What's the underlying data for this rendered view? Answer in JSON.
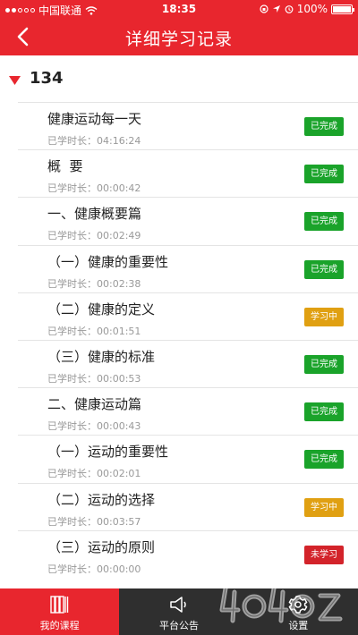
{
  "status_bar": {
    "carrier": "中国联通",
    "time": "18:35",
    "battery_percent": "100%",
    "battery_level": 1.0
  },
  "header": {
    "title": "详细学习记录",
    "back_icon": "chevron-left-icon"
  },
  "course": {
    "id": "134",
    "expand_icon": "triangle-down-icon"
  },
  "records": [
    {
      "title": "健康运动每一天",
      "time": "已学时长：04:16:24",
      "status": "已完成",
      "state": "done"
    },
    {
      "title": "概  要",
      "time": "已学时长：00:00:42",
      "status": "已完成",
      "state": "done"
    },
    {
      "title": "一、健康概要篇",
      "time": "已学时长：00:02:49",
      "status": "已完成",
      "state": "done"
    },
    {
      "title": "（一）健康的重要性",
      "time": "已学时长：00:02:38",
      "status": "已完成",
      "state": "done"
    },
    {
      "title": "（二）健康的定义",
      "time": "已学时长：00:01:51",
      "status": "学习中",
      "state": "learning"
    },
    {
      "title": "（三）健康的标准",
      "time": "已学时长：00:00:53",
      "status": "已完成",
      "state": "done"
    },
    {
      "title": "二、健康运动篇",
      "time": "已学时长：00:00:43",
      "status": "已完成",
      "state": "done"
    },
    {
      "title": "（一）运动的重要性",
      "time": "已学时长：00:02:01",
      "status": "已完成",
      "state": "done"
    },
    {
      "title": "（二）运动的选择",
      "time": "已学时长：00:03:57",
      "status": "学习中",
      "state": "learning"
    },
    {
      "title": "（三）运动的原则",
      "time": "已学时长：00:00:00",
      "status": "未学习",
      "state": "not"
    }
  ],
  "tabbar": {
    "items": [
      {
        "label": "我的课程",
        "icon": "books-icon",
        "active": true
      },
      {
        "label": "平台公告",
        "icon": "megaphone-icon",
        "active": false
      },
      {
        "label": "设置",
        "icon": "gear-icon",
        "active": false
      }
    ]
  },
  "colors": {
    "brand_red": "#e8262e",
    "done_green": "#1aa32a",
    "learning_orange": "#e0a012",
    "not_learned_red": "#d3232a",
    "tabbar_dark": "#2f2f2f"
  }
}
